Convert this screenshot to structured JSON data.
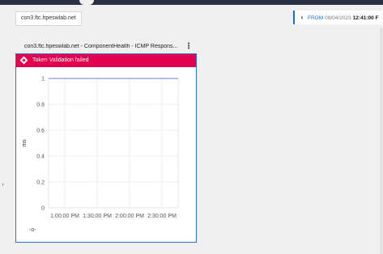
{
  "header": {
    "host_chip": "con3.ftc.hpeswlab.net",
    "time_range": {
      "from_label": "FROM",
      "from_date": "09/04/2023",
      "from_time": "12:41:00 F"
    }
  },
  "widget": {
    "title": "con3.ftc.hpeswlab.net - ComponentHealth - ICMP Respons...",
    "menu_icon": "more-vertical-icon",
    "error_banner": {
      "icon": "error-diamond-icon",
      "text": "Token Validation failed",
      "color": "#e3004f"
    },
    "legend_icon": "line-series-icon",
    "legend_glyph": "-o-"
  },
  "colors": {
    "accent": "#2b6fd6",
    "error": "#e3004f",
    "series": "#6b7fd6"
  },
  "chart_data": {
    "type": "line",
    "ylabel": "ms",
    "ylim": [
      0,
      1
    ],
    "yticks": [
      "0",
      "0.2",
      "0.4",
      "0.6",
      "0.8",
      "1"
    ],
    "xticks": [
      "1:00:00 PM",
      "1:30:00 PM",
      "2:00:00 PM",
      "2:30:00 PM"
    ],
    "grid": true,
    "series": [
      {
        "values": [
          1,
          1,
          1,
          1,
          1
        ]
      }
    ]
  }
}
